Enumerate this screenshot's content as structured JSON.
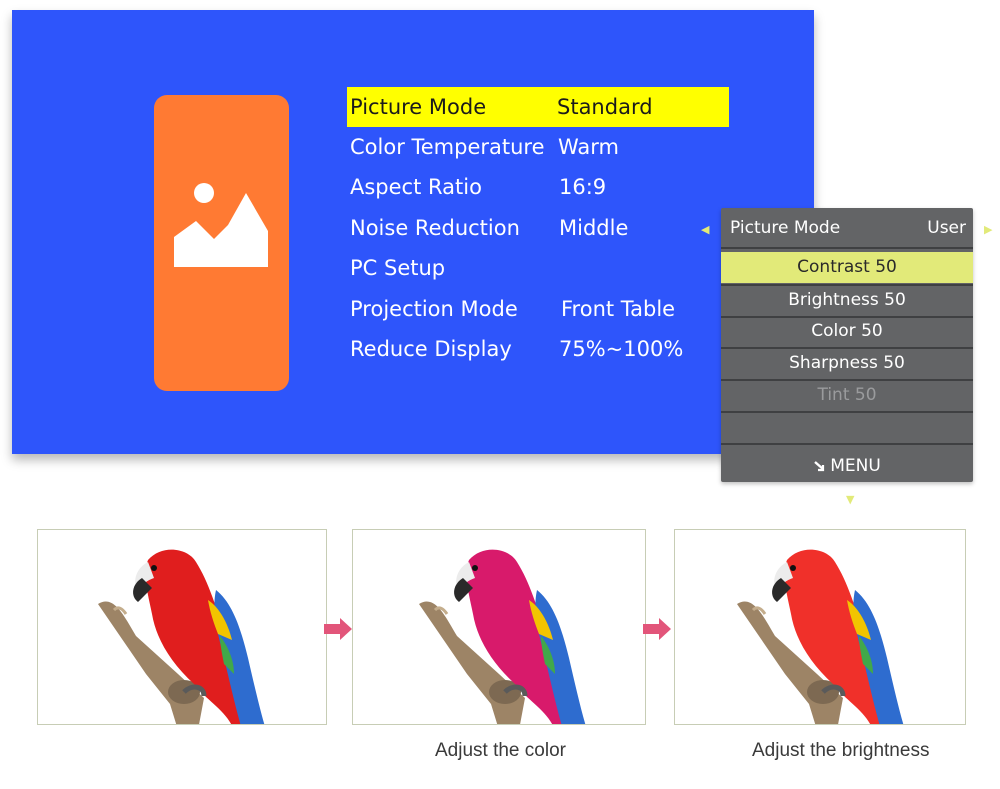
{
  "osd": {
    "menu_items": [
      {
        "label": "Picture Mode",
        "value": "Standard"
      },
      {
        "label": "Color Temperature",
        "value": "Warm"
      },
      {
        "label": "Aspect Ratio",
        "value": "16:9"
      },
      {
        "label": "Noise Reduction",
        "value": "Middle"
      },
      {
        "label": "PC Setup",
        "value": ""
      },
      {
        "label": "Projection Mode",
        "value": "Front Table"
      },
      {
        "label": "Reduce Display",
        "value": "75%~100%"
      }
    ],
    "selected_index": 0,
    "thumbnail_icon": "image-placeholder-icon"
  },
  "submenu": {
    "title": "Picture Mode",
    "mode_value": "User",
    "items": [
      {
        "label": "Contrast 50",
        "state": "active"
      },
      {
        "label": "Brightness 50",
        "state": "normal"
      },
      {
        "label": "Color 50",
        "state": "normal"
      },
      {
        "label": "Sharpness 50",
        "state": "normal"
      },
      {
        "label": "Tint 50",
        "state": "disabled"
      }
    ],
    "footer_label": "MENU",
    "footer_icon": "return-arrow-icon"
  },
  "comparison": {
    "captions": [
      "Adjust the color",
      "Adjust the brightness"
    ],
    "images": [
      "parrot-original",
      "parrot-color-adjusted",
      "parrot-brightness-adjusted"
    ]
  },
  "colors": {
    "osd_background": "#2e55fb",
    "selection_highlight": "#ffff00",
    "submenu_highlight": "#e2ea79",
    "thumbnail_card": "#ff7a33",
    "flow_arrow": "#e2557a"
  }
}
